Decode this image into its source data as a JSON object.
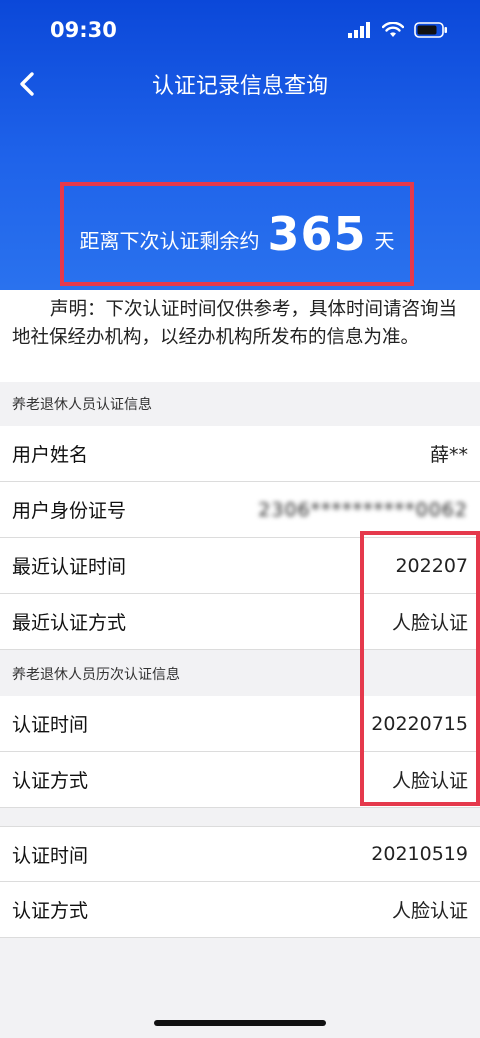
{
  "status_bar": {
    "time": "09:30"
  },
  "nav": {
    "title": "认证记录信息查询"
  },
  "countdown": {
    "prefix": "距离下次认证剩余约",
    "days": "365",
    "suffix": "天"
  },
  "notice": "声明：下次认证时间仅供参考，具体时间请咨询当地社保经办机构，以经办机构所发布的信息为准。",
  "section1": {
    "title": "养老退休人员认证信息",
    "rows": [
      {
        "label": "用户姓名",
        "value": "薛**"
      },
      {
        "label": "用户身份证号",
        "value": "2306**********0062"
      },
      {
        "label": "最近认证时间",
        "value": "202207"
      },
      {
        "label": "最近认证方式",
        "value": "人脸认证"
      }
    ]
  },
  "section2": {
    "title": "养老退休人员历次认证信息",
    "records": [
      [
        {
          "label": "认证时间",
          "value": "20220715"
        },
        {
          "label": "认证方式",
          "value": "人脸认证"
        }
      ],
      [
        {
          "label": "认证时间",
          "value": "20210519"
        },
        {
          "label": "认证方式",
          "value": "人脸认证"
        }
      ]
    ]
  },
  "colors": {
    "header_blue": "#1f63ea",
    "highlight_red": "#e5394c"
  },
  "icons": [
    "back-chevron-icon",
    "signal-icon",
    "wifi-icon",
    "battery-icon"
  ]
}
